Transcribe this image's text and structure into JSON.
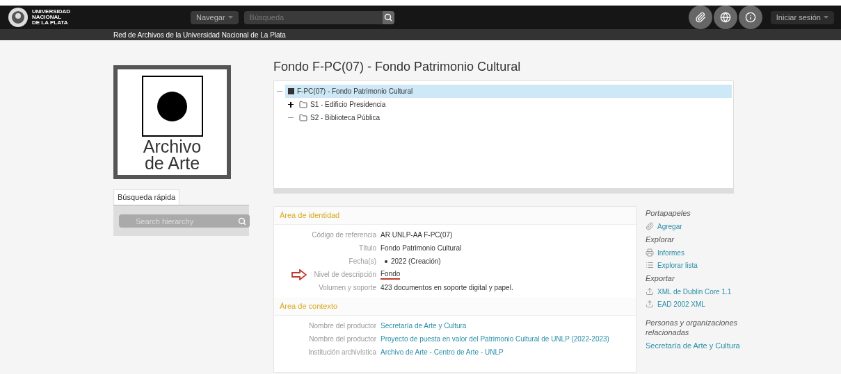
{
  "header": {
    "logo_lines": [
      "UNIVERSIDAD",
      "NACIONAL",
      "DE LA PLATA"
    ],
    "browse": "Navegar",
    "search": {
      "placeholder": "Búsqueda"
    },
    "login": "Iniciar sesión"
  },
  "subbar": "Red de Archivos de la Universidad Nacional de La Plata",
  "logo": {
    "lines": [
      "Archivo",
      "de Arte"
    ]
  },
  "quick_search": {
    "tab": "Búsqueda rápida",
    "placeholder": "Search hierarchy"
  },
  "title": "Fondo F-PC(07) - Fondo Patrimonio Cultural",
  "tree": [
    {
      "label": "F-PC(07) - Fondo Patrimonio Cultural",
      "selected": true,
      "children": [
        {
          "label": "S1 - Edificio Presidencia",
          "selected": false,
          "expandable": true
        },
        {
          "label": "S2 - Biblioteca Pública",
          "selected": false,
          "expandable": false
        }
      ]
    }
  ],
  "areas": [
    {
      "heading": "Área de identidad",
      "rows": [
        {
          "label": "Código de referencia",
          "value": "AR UNLP-AA F-PC(07)",
          "kind": "text",
          "annotated": false
        },
        {
          "label": "Título",
          "value": "Fondo Patrimonio Cultural",
          "kind": "text",
          "annotated": false
        },
        {
          "label": "Fecha(s)",
          "value": "2022 (Creación)",
          "kind": "bullet",
          "annotated": false
        },
        {
          "label": "Nivel de descripción",
          "value": "Fondo",
          "kind": "text",
          "annotated": true
        },
        {
          "label": "Volumen y soporte",
          "value": "423 documentos en soporte digital y papel.",
          "kind": "text",
          "annotated": false
        }
      ]
    },
    {
      "heading": "Área de contexto",
      "rows": [
        {
          "label": "Nombre del productor",
          "value": "Secretaría de Arte y Cultura",
          "kind": "link",
          "annotated": false
        },
        {
          "label": "Nombre del productor",
          "value": "Proyecto de puesta en valor del Patrimonio Cultural de UNLP (2022-2023)",
          "kind": "link",
          "annotated": false
        },
        {
          "label": "Institución archivística",
          "value": "Archivo de Arte - Centro de Arte - UNLP",
          "kind": "link",
          "annotated": false
        }
      ]
    }
  ],
  "sidebar": [
    {
      "heading": "Portapapeles",
      "items": [
        {
          "label": "Agregar",
          "kind": "clip"
        }
      ]
    },
    {
      "heading": "Explorar",
      "items": [
        {
          "label": "Informes",
          "kind": "print"
        },
        {
          "label": "Explorar lista",
          "kind": "list"
        }
      ]
    },
    {
      "heading": "Exportar",
      "items": [
        {
          "label": "XML de Dublin Core 1.1",
          "kind": "upload"
        },
        {
          "label": "EAD 2002 XML",
          "kind": "upload"
        }
      ]
    },
    {
      "heading": "Personas y organizaciones relacionadas",
      "items": [
        {
          "label": "Secretaría de Arte y Cultura",
          "kind": "plain"
        }
      ]
    }
  ]
}
